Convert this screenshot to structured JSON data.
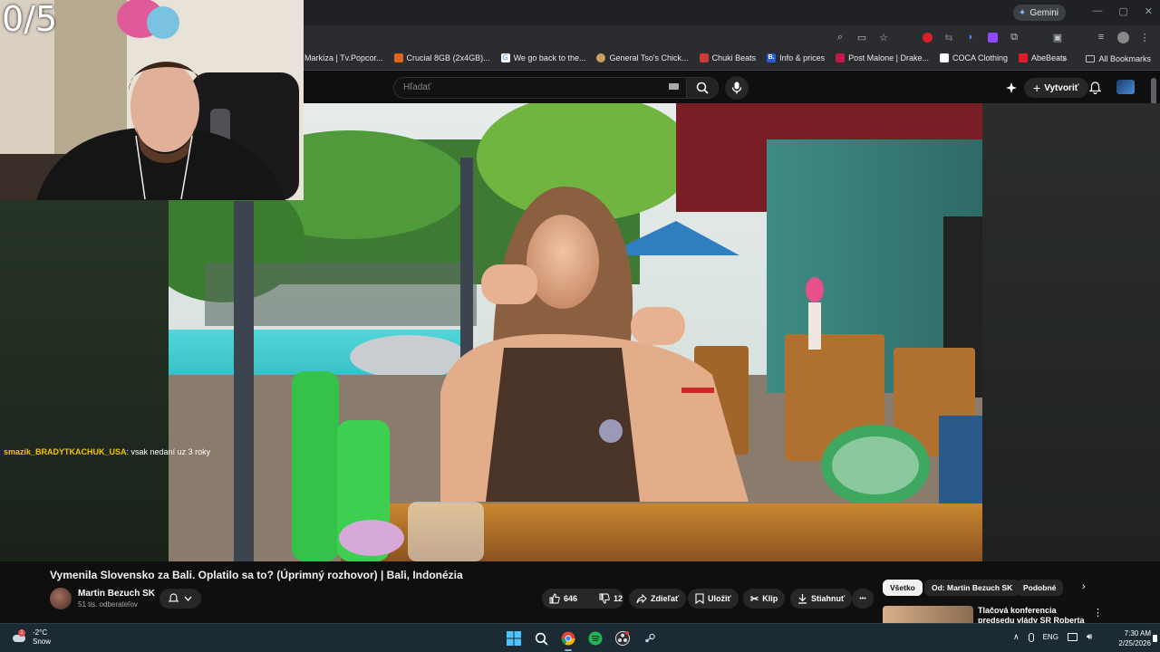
{
  "score": "0/5",
  "browser": {
    "gemini_label": "Gemini",
    "window_controls": [
      "—",
      "▢",
      "✕"
    ],
    "bookmarks": [
      {
        "label": "Markíza | Tv.Popcor...",
        "color": "#1a1a1a"
      },
      {
        "label": "Crucial 8GB (2x4GB)...",
        "color": "#e0641e"
      },
      {
        "label": "We go back to the...",
        "color": "#4285f4"
      },
      {
        "label": "General Tso's Chick...",
        "color": "#c9a060"
      },
      {
        "label": "Chuki Beats",
        "color": "#d03a3a"
      },
      {
        "label": "Info & prices",
        "color": "#2a5bd7"
      },
      {
        "label": "Post Malone | Drake...",
        "color": "#c3184a"
      },
      {
        "label": "COCA Clothing",
        "color": "#1a1a1a"
      },
      {
        "label": "AbeBeats",
        "color": "#e01e2a"
      }
    ],
    "all_bookmarks_label": "All Bookmarks"
  },
  "youtube": {
    "search_placeholder": "Hľadať",
    "create_label": "Vytvoriť"
  },
  "chat": {
    "user": "smazik_BRADYTKACHUK_USA",
    "message": ": vsak nedaní uz 3 roky"
  },
  "video": {
    "title": "Vymenila Slovensko za Bali. Oplatilo sa to? (Úprimný rozhovor) | Bali, Indonézia",
    "channel_name": "Martin Bezuch SK",
    "channel_subs": "51 tis. odberateľov",
    "likes": "646",
    "dislikes": "12",
    "share_label": "Zdieľať",
    "save_label": "Uložiť",
    "clip_label": "Klip",
    "download_label": "Stiahnuť",
    "more_label": "•••"
  },
  "chips": [
    "Všetko",
    "Od: Martin Bezuch SK",
    "Podobné"
  ],
  "recommendation": {
    "title": "Tlačová konferencia predsedu vlády SR Roberta Fica po"
  },
  "taskbar": {
    "temperature": "-2°C",
    "weather": "Snow",
    "language": "ENG",
    "time": "7:30 AM",
    "date": "2/25/2026"
  }
}
